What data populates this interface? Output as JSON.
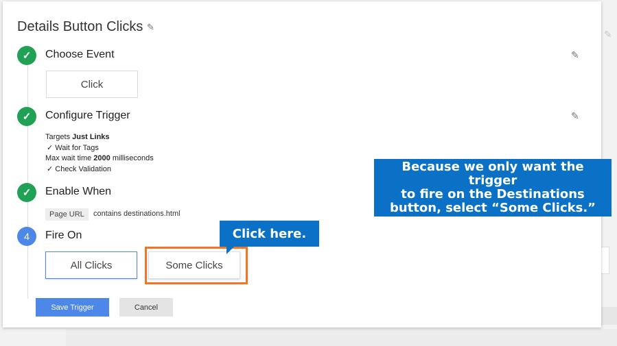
{
  "panel": {
    "title": "Details Button Clicks",
    "edit_icon": "pencil-icon"
  },
  "steps": {
    "choose_event": {
      "label": "Choose Event",
      "status_icon": "check-icon",
      "selected_event": "Click"
    },
    "configure_trigger": {
      "label": "Configure Trigger",
      "status_icon": "check-icon",
      "targets_prefix": "Targets ",
      "targets_value": "Just Links",
      "wait_for_tags": "✓ Wait for Tags",
      "max_wait_prefix": "Max wait time ",
      "max_wait_value": "2000",
      "max_wait_suffix": " milliseconds",
      "check_validation": "✓ Check Validation"
    },
    "enable_when": {
      "label": "Enable When",
      "status_icon": "check-icon",
      "variable_chip": "Page URL",
      "condition": "contains destinations.html"
    },
    "fire_on": {
      "number": "4",
      "label": "Fire On",
      "options": [
        "All Clicks",
        "Some Clicks"
      ],
      "selected": "All Clicks",
      "highlighted": "Some Clicks"
    }
  },
  "actions": {
    "save_label": "Save Trigger",
    "cancel_label": "Cancel"
  },
  "annotations": {
    "click_here": "Click here.",
    "explanation_lines": [
      "Because we only want the trigger",
      "to fire on the Destinations",
      "button, select “Some Clicks.”"
    ]
  },
  "colors": {
    "step_complete": "#21a154",
    "step_active": "#4d88e8",
    "primary_button": "#4d88e8",
    "callout": "#0a71c6",
    "highlight_frame": "#f07526"
  }
}
